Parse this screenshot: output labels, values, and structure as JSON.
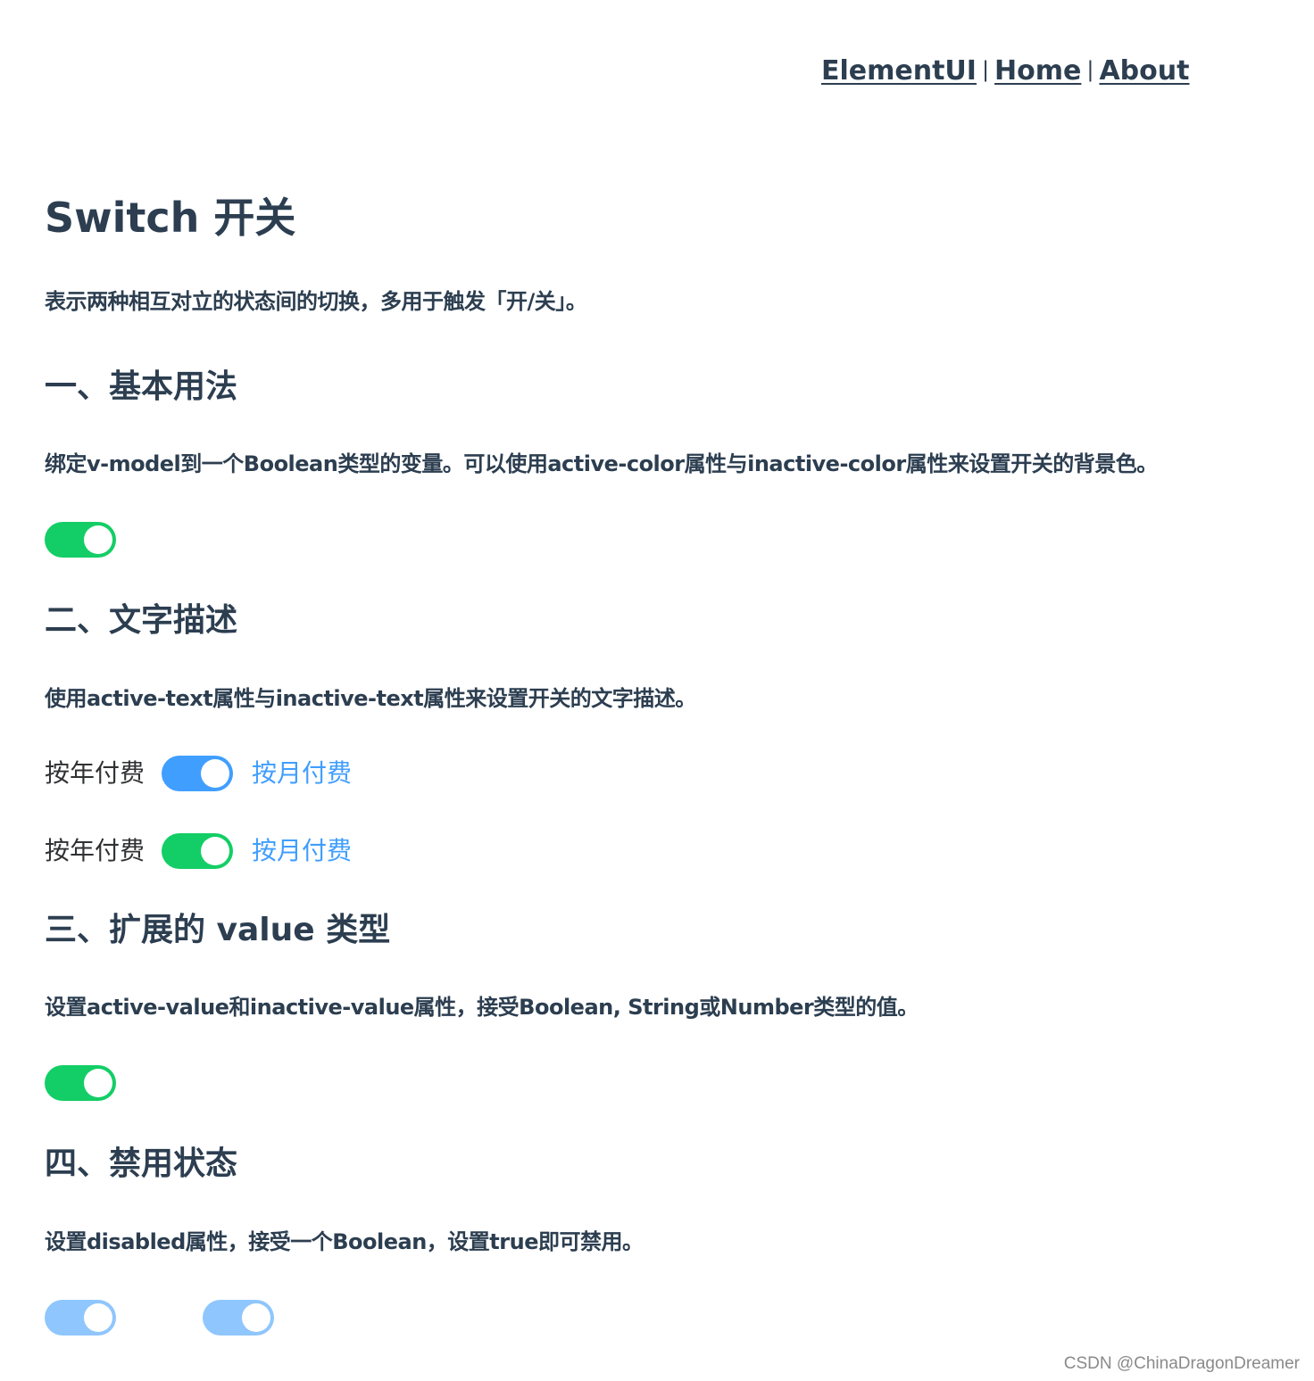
{
  "nav": {
    "links": [
      {
        "label": "ElementUI"
      },
      {
        "label": "Home"
      },
      {
        "label": "About"
      }
    ],
    "separator": "|"
  },
  "page": {
    "title": "Switch 开关",
    "intro": "表示两种相互对立的状态间的切换，多用于触发「开/关」。"
  },
  "sections": [
    {
      "title": "一、基本用法",
      "description": "绑定v-model到一个Boolean类型的变量。可以使用active-color属性与inactive-color属性来设置开关的背景色。",
      "switches": [
        {
          "on": true,
          "active_color": "#13ce66",
          "disabled": false
        }
      ]
    },
    {
      "title": "二、文字描述",
      "description": "使用active-text属性与inactive-text属性来设置开关的文字描述。",
      "rows": [
        {
          "inactive_text": "按年付费",
          "active_text": "按月付费",
          "on": true,
          "active_color": "#409eff",
          "active_text_color": "#409eff",
          "inactive_text_color": "#303133"
        },
        {
          "inactive_text": "按年付费",
          "active_text": "按月付费",
          "on": true,
          "active_color": "#13ce66",
          "active_text_color": "#409eff",
          "inactive_text_color": "#303133"
        }
      ]
    },
    {
      "title": "三、扩展的 value 类型",
      "description": "设置active-value和inactive-value属性，接受Boolean, String或Number类型的值。",
      "switches": [
        {
          "on": true,
          "active_color": "#13ce66",
          "disabled": false
        }
      ]
    },
    {
      "title": "四、禁用状态",
      "description": "设置disabled属性，接受一个Boolean，设置true即可禁用。",
      "switches": [
        {
          "on": true,
          "active_color": "#409eff",
          "disabled": true
        },
        {
          "on": true,
          "active_color": "#409eff",
          "disabled": true
        }
      ]
    }
  ],
  "watermark": "CSDN @ChinaDragonDreamer",
  "colors": {
    "text": "#2c3e50",
    "green": "#13ce66",
    "blue": "#409eff",
    "disabled_blue": "#8fc6fd"
  }
}
